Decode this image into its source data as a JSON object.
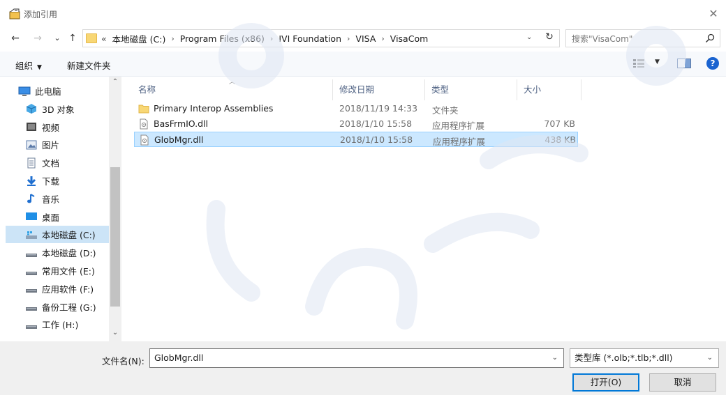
{
  "window": {
    "title": "添加引用",
    "close_glyph": "✕"
  },
  "nav": {
    "back_glyph": "←",
    "forward_glyph": "→",
    "recent_glyph": "⌄",
    "up_glyph": "↑"
  },
  "address": {
    "overflow": "«",
    "crumbs": [
      "本地磁盘 (C:)",
      "Program Files (x86)",
      "IVI Foundation",
      "VISA",
      "VisaCom"
    ],
    "separator": "›",
    "dropdown_glyph": "⌄",
    "refresh_glyph": "↻"
  },
  "search": {
    "placeholder": "搜索\"VisaCom\""
  },
  "toolbar": {
    "organize": "组织",
    "new_folder": "新建文件夹",
    "help": "?"
  },
  "sidebar": {
    "items": [
      {
        "label": "此电脑",
        "icon": "computer-icon"
      },
      {
        "label": "3D 对象",
        "icon": "3d-objects-icon"
      },
      {
        "label": "视频",
        "icon": "video-icon"
      },
      {
        "label": "图片",
        "icon": "pictures-icon"
      },
      {
        "label": "文档",
        "icon": "documents-icon"
      },
      {
        "label": "下载",
        "icon": "download-icon"
      },
      {
        "label": "音乐",
        "icon": "music-icon"
      },
      {
        "label": "桌面",
        "icon": "desktop-icon"
      },
      {
        "label": "本地磁盘 (C:)",
        "icon": "system-drive-icon"
      },
      {
        "label": "本地磁盘 (D:)",
        "icon": "drive-icon"
      },
      {
        "label": "常用文件 (E:)",
        "icon": "drive-icon"
      },
      {
        "label": "应用软件 (F:)",
        "icon": "drive-icon"
      },
      {
        "label": "备份工程 (G:)",
        "icon": "drive-icon"
      },
      {
        "label": "工作 (H:)",
        "icon": "drive-icon"
      }
    ],
    "selected_index": 8
  },
  "columns": {
    "name": "名称",
    "modified": "修改日期",
    "type": "类型",
    "size": "大小"
  },
  "files": [
    {
      "name": "Primary Interop Assemblies",
      "modified": "2018/11/19 14:33",
      "type": "文件夹",
      "size": "",
      "icon": "folder-icon"
    },
    {
      "name": "BasFrmIO.dll",
      "modified": "2018/1/10 15:58",
      "type": "应用程序扩展",
      "size": "707 KB",
      "icon": "dll-file-icon"
    },
    {
      "name": "GlobMgr.dll",
      "modified": "2018/1/10 15:58",
      "type": "应用程序扩展",
      "size": "438 KB",
      "icon": "dll-file-icon"
    }
  ],
  "selected_file_index": 2,
  "footer": {
    "filename_label": "文件名(N):",
    "filename_value": "GlobMgr.dll",
    "filter_value": "类型库 (*.olb;*.tlb;*.dll)",
    "open_label": "打开(O)",
    "cancel_label": "取消"
  },
  "colors": {
    "selection_bg": "#cce8ff",
    "selection_border": "#99d1ff",
    "accent": "#0078d7",
    "folder": "#f8d775",
    "watermark": "#dfe6f3"
  }
}
